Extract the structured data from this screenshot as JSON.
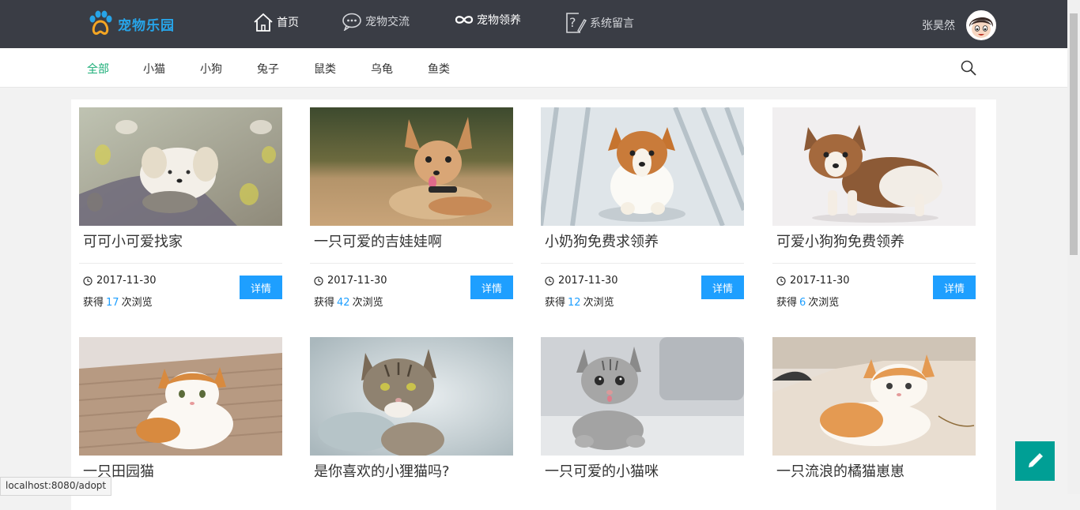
{
  "app": {
    "name": "宠物乐园"
  },
  "nav": {
    "items": [
      {
        "label": "首页",
        "icon": "home-icon"
      },
      {
        "label": "宠物交流",
        "icon": "chat-icon"
      },
      {
        "label": "宠物领养",
        "icon": "infinity-icon"
      },
      {
        "label": "系统留言",
        "icon": "help-icon"
      }
    ]
  },
  "user": {
    "name": "张昊然"
  },
  "categories": [
    "全部",
    "小猫",
    "小狗",
    "兔子",
    "鼠类",
    "乌龟",
    "鱼类"
  ],
  "active_category": "全部",
  "cards": [
    {
      "title": "可可小可爱找家",
      "date": "2017-11-30",
      "views_prefix": "获得",
      "views": "17",
      "views_suffix": "次浏览",
      "button": "详情"
    },
    {
      "title": "一只可爱的吉娃娃啊",
      "date": "2017-11-30",
      "views_prefix": "获得",
      "views": "42",
      "views_suffix": "次浏览",
      "button": "详情"
    },
    {
      "title": "小奶狗免费求领养",
      "date": "2017-11-30",
      "views_prefix": "获得",
      "views": "12",
      "views_suffix": "次浏览",
      "button": "详情"
    },
    {
      "title": "可爱小狗狗免费领养",
      "date": "2017-11-30",
      "views_prefix": "获得",
      "views": "6",
      "views_suffix": "次浏览",
      "button": "详情"
    },
    {
      "title": "一只田园猫"
    },
    {
      "title": "是你喜欢的小狸猫吗?"
    },
    {
      "title": "一只可爱的小猫咪"
    },
    {
      "title": "一只流浪的橘猫崽崽"
    }
  ],
  "status_url": "localhost:8080/adopt",
  "colors": {
    "topbar": "#3a3d45",
    "accent": "#1e9fff",
    "active_category": "#1aad77",
    "fab": "#009f95"
  }
}
